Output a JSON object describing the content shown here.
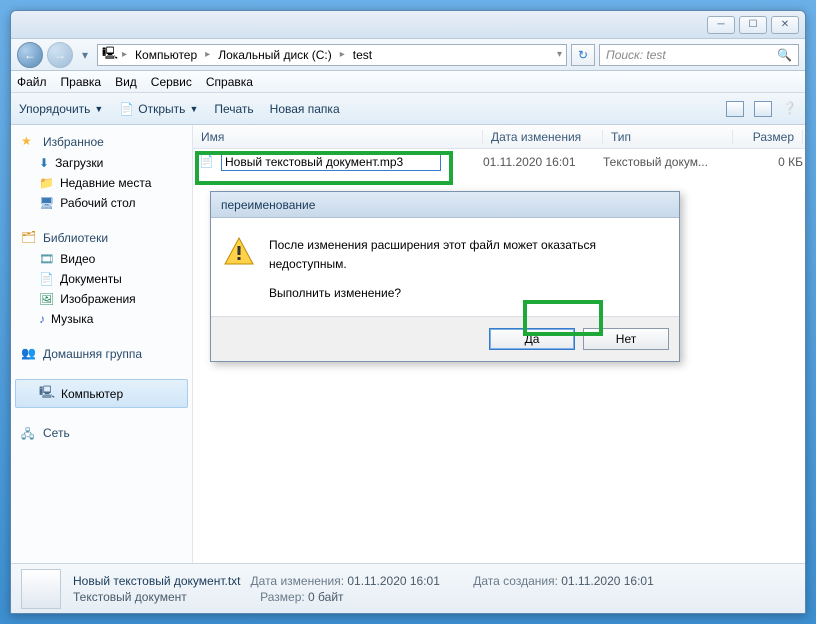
{
  "titlebar": {},
  "nav": {
    "breadcrumb": {
      "computer": "Компьютер",
      "drive": "Локальный диск (C:)",
      "folder": "test"
    }
  },
  "search": {
    "placeholder": "Поиск: test"
  },
  "menu": {
    "file": "Файл",
    "edit": "Правка",
    "view": "Вид",
    "tools": "Сервис",
    "help": "Справка"
  },
  "toolbar": {
    "organize": "Упорядочить",
    "open": "Открыть",
    "print": "Печать",
    "newfolder": "Новая папка"
  },
  "sidebar": {
    "favorites": {
      "label": "Избранное",
      "items": {
        "downloads": "Загрузки",
        "recent": "Недавние места",
        "desktop": "Рабочий стол"
      }
    },
    "libraries": {
      "label": "Библиотеки",
      "items": {
        "video": "Видео",
        "documents": "Документы",
        "pictures": "Изображения",
        "music": "Музыка"
      }
    },
    "homegroup": "Домашняя группа",
    "computer": "Компьютер",
    "network": "Сеть"
  },
  "columns": {
    "name": "Имя",
    "modified": "Дата изменения",
    "type": "Тип",
    "size": "Размер"
  },
  "file": {
    "editname": "Новый текстовый документ.mp3",
    "modified": "01.11.2020 16:01",
    "type": "Текстовый докум...",
    "size": "0 КБ"
  },
  "dialog": {
    "title": "переименование",
    "line1": "После изменения расширения этот файл может оказаться недоступным.",
    "line2": "Выполнить изменение?",
    "yes": "Да",
    "no": "Нет"
  },
  "status": {
    "title": "Новый текстовый документ.txt",
    "subtitle": "Текстовый документ",
    "modlabel": "Дата изменения:",
    "modval": "01.11.2020 16:01",
    "sizelabel": "Размер:",
    "sizeval": "0 байт",
    "createdlabel": "Дата создания:",
    "createdval": "01.11.2020 16:01"
  }
}
